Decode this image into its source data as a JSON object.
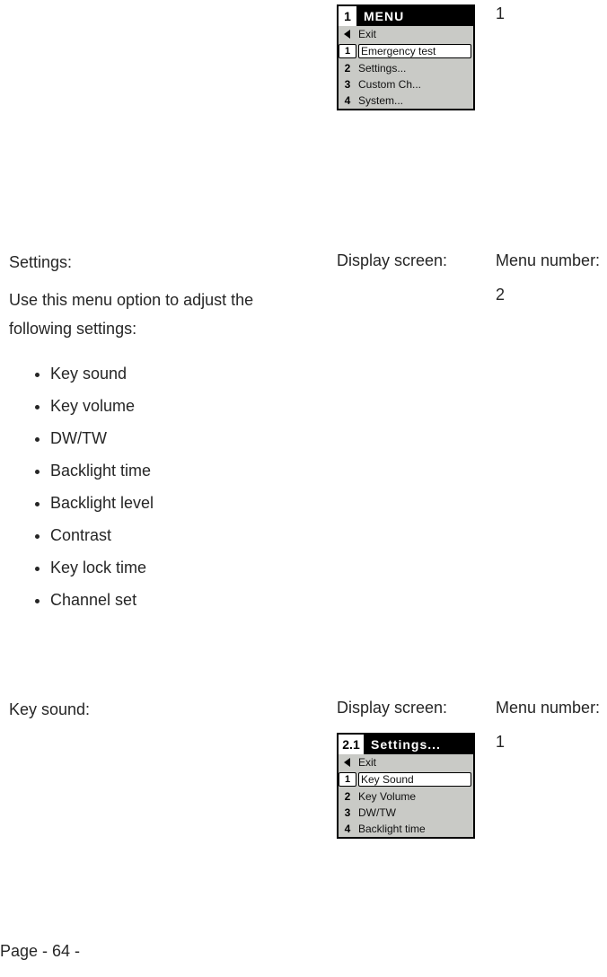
{
  "block1": {
    "menu_number_value": "1",
    "lcd": {
      "title_num": "1",
      "title_text": "MENU",
      "rows": [
        {
          "idx_type": "arrow",
          "idx": "",
          "label": "Exit",
          "selected": false
        },
        {
          "idx_type": "num",
          "idx": "1",
          "label": "Emergency test",
          "selected": true
        },
        {
          "idx_type": "num",
          "idx": "2",
          "label": "Settings...",
          "selected": false
        },
        {
          "idx_type": "num",
          "idx": "3",
          "label": "Custom Ch...",
          "selected": false
        },
        {
          "idx_type": "num",
          "idx": "4",
          "label": "System...",
          "selected": false
        }
      ]
    }
  },
  "block2": {
    "heading": "Settings:",
    "display_screen_label": "Display screen:",
    "menu_number_label": "Menu number:",
    "menu_number_value": "2",
    "description": "Use this menu option to adjust the following settings:",
    "bullets": [
      "Key sound",
      "Key volume",
      "DW/TW",
      "Backlight time",
      "Backlight level",
      "Contrast",
      "Key lock time",
      "Channel set"
    ]
  },
  "block3": {
    "heading": "Key sound:",
    "display_screen_label": "Display screen:",
    "menu_number_label": "Menu number:",
    "menu_number_value": "1",
    "lcd": {
      "title_num": "2.1",
      "title_text": "Settings...",
      "rows": [
        {
          "idx_type": "arrow",
          "idx": "",
          "label": "Exit",
          "selected": false
        },
        {
          "idx_type": "num",
          "idx": "1",
          "label": "Key Sound",
          "selected": true
        },
        {
          "idx_type": "num",
          "idx": "2",
          "label": "Key Volume",
          "selected": false
        },
        {
          "idx_type": "num",
          "idx": "3",
          "label": "DW/TW",
          "selected": false
        },
        {
          "idx_type": "num",
          "idx": "4",
          "label": "Backlight time",
          "selected": false
        }
      ]
    }
  },
  "footer": "Page - 64 -"
}
